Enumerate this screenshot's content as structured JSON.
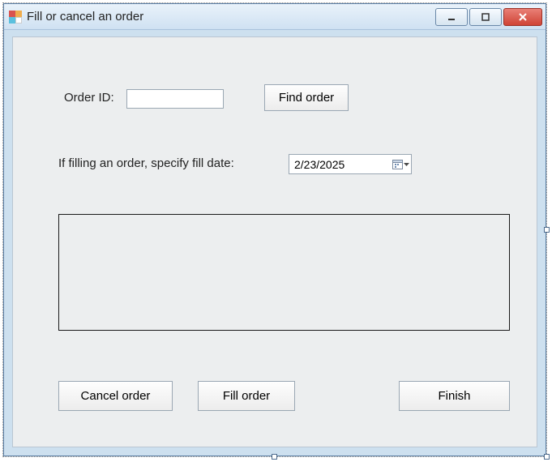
{
  "window": {
    "title": "Fill or cancel an order"
  },
  "form": {
    "orderId": {
      "label": "Order ID:",
      "value": ""
    },
    "findOrder": {
      "label": "Find order"
    },
    "fillDate": {
      "label": "If filling an order, specify fill date:",
      "value": "2/23/2025"
    },
    "cancelOrder": {
      "label": "Cancel order"
    },
    "fillOrder": {
      "label": "Fill order"
    },
    "finish": {
      "label": "Finish"
    }
  }
}
